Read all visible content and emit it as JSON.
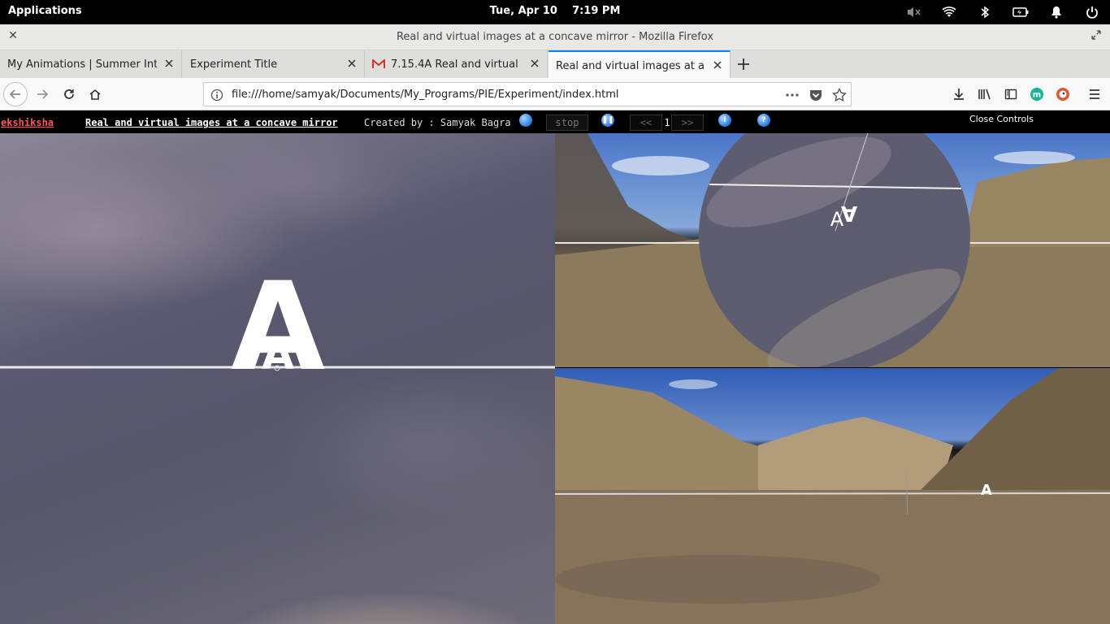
{
  "topbar": {
    "applications": "Applications",
    "clock": "Tue, Apr 10    7:19 PM"
  },
  "window": {
    "title": "Real and virtual images at a concave mirror - Mozilla Firefox"
  },
  "tabs": [
    {
      "label": "My Animations | Summer Interns"
    },
    {
      "label": "Experiment Title"
    },
    {
      "label": "7.15.4A Real and virtual imag"
    },
    {
      "label": "Real and virtual images at a conca"
    }
  ],
  "navbar": {
    "url": "file:///home/samyak/Documents/My_Programs/PIE/Experiment/index.html"
  },
  "controls": {
    "brand": "ekshiksha",
    "experiment_title": "Real and virtual images at a concave mirror",
    "creator": "Created by : Samyak Bagra",
    "stop_label": "stop",
    "prev_label": "<<",
    "step_value": "1",
    "next_label": ">>",
    "close_controls": "Close Controls"
  },
  "scene": {
    "object_letter": "A"
  }
}
